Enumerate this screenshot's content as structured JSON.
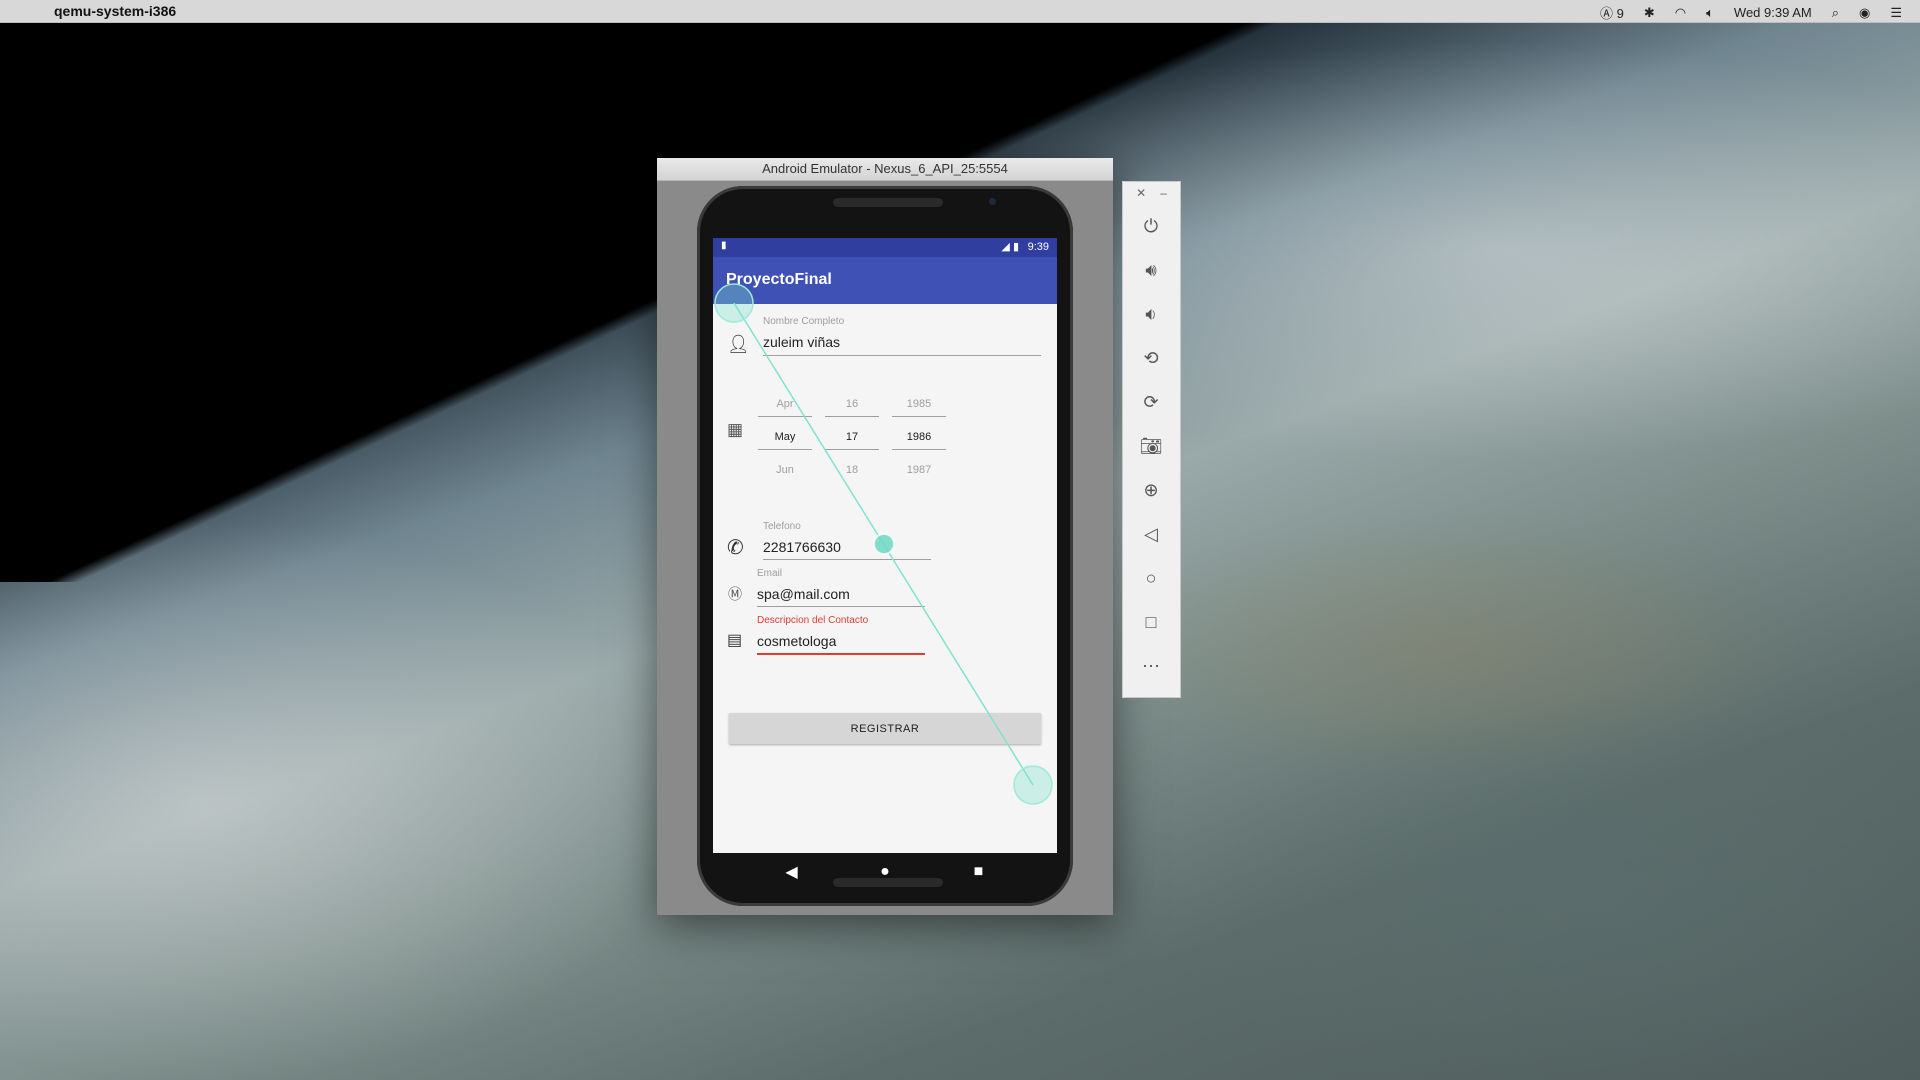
{
  "menubar": {
    "app_name": "qemu-system-i386",
    "status_text": "9",
    "clock": "Wed 9:39 AM"
  },
  "emulator": {
    "title": "Android Emulator - Nexus_6_API_25:5554"
  },
  "android": {
    "status_time": "9:39",
    "app_title": "ProyectoFinal",
    "name_label": "Nombre Completo",
    "name_value": "zuleim viñas",
    "date_picker": {
      "months": [
        "Apr",
        "May",
        "Jun"
      ],
      "days": [
        "16",
        "17",
        "18"
      ],
      "years": [
        "1985",
        "1986",
        "1987"
      ]
    },
    "phone_label": "Telefono",
    "phone_value": "2281766630",
    "email_label": "Email",
    "email_value": "spa@mail.com",
    "desc_label": "Descripcion del Contacto",
    "desc_value": "cosmetologa",
    "register_label": "REGISTRAR",
    "error_color": "#e53935",
    "accent_color": "#3f51b5",
    "primary_dark": "#303f9f"
  },
  "toolbar": {
    "icons": [
      "power-icon",
      "volume-up-icon",
      "volume-down-icon",
      "rotate-left-icon",
      "rotate-right-icon",
      "camera-icon",
      "zoom-icon",
      "back-icon",
      "home-icon",
      "overview-icon",
      "more-icon"
    ]
  }
}
